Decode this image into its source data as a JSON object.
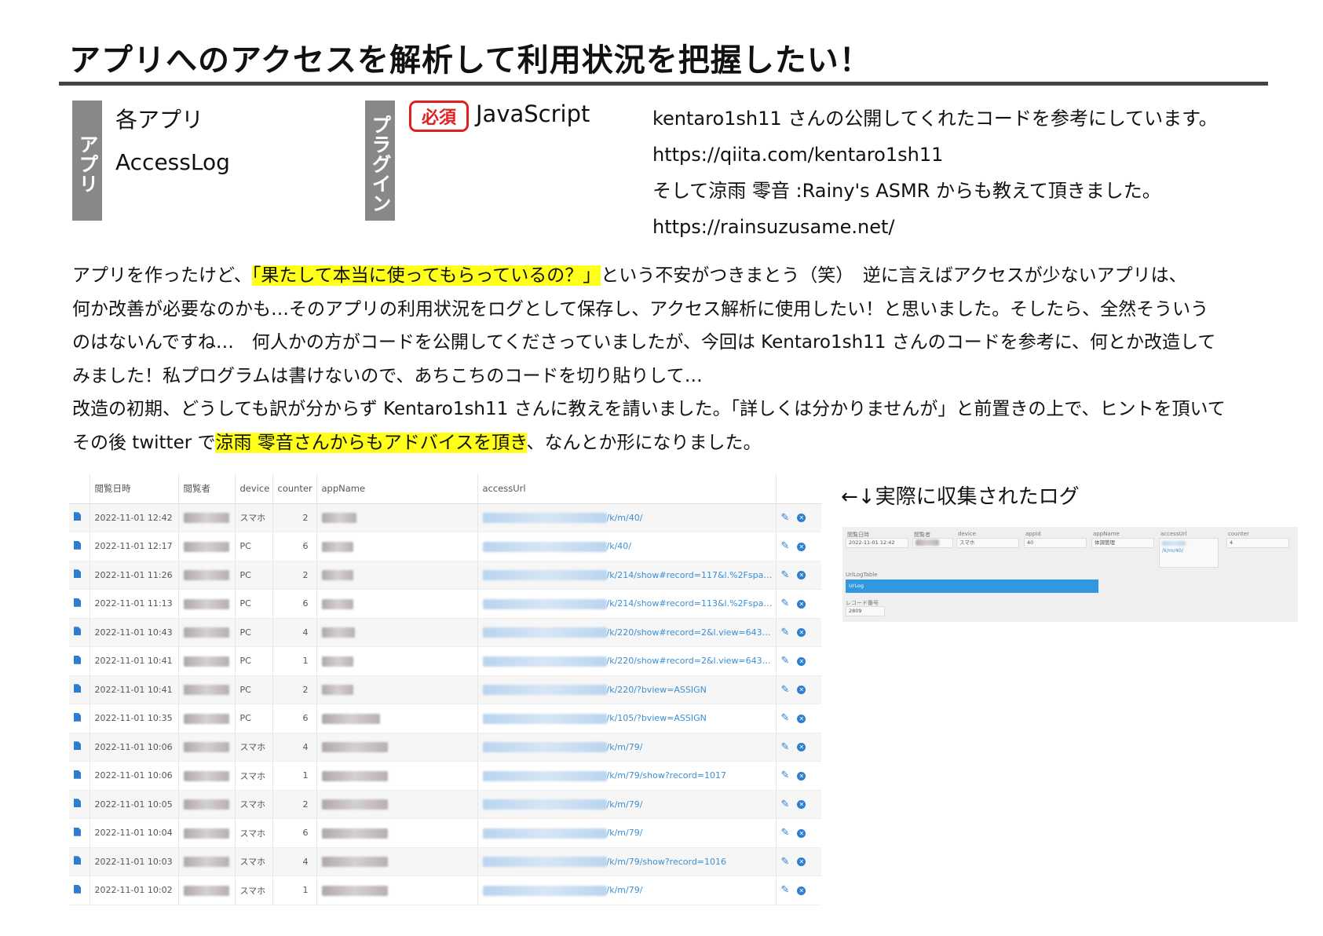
{
  "title": "アプリへのアクセスを解析して利用状況を把握したい！",
  "app_label": "アプリ",
  "app_names": [
    "各アプリ",
    "AccessLog"
  ],
  "plugin_label": "プラグイン",
  "required_badge": "必須",
  "required_value": "JavaScript",
  "credits": [
    "kentaro1sh11 さんの公開してくれたコードを参考にしています。",
    "https://qiita.com/kentaro1sh11",
    "そして涼雨 零音 :Rainy's ASMR からも教えて頂きました。",
    "https://rainsuzusame.net/"
  ],
  "body": {
    "l1_a": "アプリを作ったけど、",
    "l1_hl": "「果たして本当に使ってもらっているの？」",
    "l1_b": "という不安がつきまとう（笑）　逆に言えばアクセスが少ないアプリは、",
    "l2": "何か改善が必要なのかも…そのアプリの利用状況をログとして保存し、アクセス解析に使用したい！と思いました。そしたら、全然そういう",
    "l3": "のはないんですね…　何人かの方がコードを公開してくださっていましたが、今回は Kentaro1sh11 さんのコードを参考に、何とか改造して",
    "l4": "みました！私プログラムは書けないので、あちこちのコードを切り貼りして…",
    "l5": "改造の初期、どうしても訳が分からず Kentaro1sh11 さんに教えを請いました。「詳しくは分かりませんが」と前置きの上で、ヒントを頂いて",
    "l6_a": "その後 twitter で",
    "l6_hl": "涼雨 零音さんからもアドバイスを頂き",
    "l6_b": "、なんとか形になりました。"
  },
  "log_table": {
    "headers": [
      "閲覧日時",
      "閲覧者",
      "device",
      "counter",
      "appName",
      "accessUrl"
    ],
    "rows": [
      {
        "date": "2022-11-01 12:42",
        "device": "スマホ",
        "counter": "2",
        "url": "/k/m/40/"
      },
      {
        "date": "2022-11-01 12:17",
        "device": "PC",
        "counter": "6",
        "url": "/k/40/"
      },
      {
        "date": "2022-11-01 11:26",
        "device": "PC",
        "counter": "2",
        "url": "/k/214/show#record=117&l.%2Fspa…"
      },
      {
        "date": "2022-11-01 11:13",
        "device": "PC",
        "counter": "6",
        "url": "/k/214/show#record=113&l.%2Fspa…"
      },
      {
        "date": "2022-11-01 10:43",
        "device": "PC",
        "counter": "4",
        "url": "/k/220/show#record=2&l.view=643…"
      },
      {
        "date": "2022-11-01 10:41",
        "device": "PC",
        "counter": "1",
        "url": "/k/220/show#record=2&l.view=643…"
      },
      {
        "date": "2022-11-01 10:41",
        "device": "PC",
        "counter": "2",
        "url": "/k/220/?bview=ASSIGN"
      },
      {
        "date": "2022-11-01 10:35",
        "device": "PC",
        "counter": "6",
        "url": "/k/105/?bview=ASSIGN"
      },
      {
        "date": "2022-11-01 10:06",
        "device": "スマホ",
        "counter": "4",
        "url": "/k/m/79/"
      },
      {
        "date": "2022-11-01 10:06",
        "device": "スマホ",
        "counter": "1",
        "url": "/k/m/79/show?record=1017"
      },
      {
        "date": "2022-11-01 10:05",
        "device": "スマホ",
        "counter": "2",
        "url": "/k/m/79/"
      },
      {
        "date": "2022-11-01 10:04",
        "device": "スマホ",
        "counter": "6",
        "url": "/k/m/79/"
      },
      {
        "date": "2022-11-01 10:03",
        "device": "スマホ",
        "counter": "4",
        "url": "/k/m/79/show?record=1016"
      },
      {
        "date": "2022-11-01 10:02",
        "device": "スマホ",
        "counter": "1",
        "url": "/k/m/79/"
      }
    ]
  },
  "log_caption": "←↓実際に収集されたログ",
  "detail": {
    "labels": {
      "date": "閲覧日時",
      "user": "閲覧者",
      "device": "device",
      "appid": "appId",
      "appname": "appName",
      "url": "accessUrl",
      "counter": "counter",
      "table": "UrlLogTable",
      "record": "レコード番号"
    },
    "values": {
      "date": "2022-11-01 12:42",
      "device": "スマホ",
      "appid": "40",
      "appname": "体調管理",
      "url": "/k/m/40/",
      "counter": "4",
      "table": "UrLog",
      "record": "2809"
    }
  },
  "colors": {
    "highlight": "#ffff1a",
    "badge": "#e02020",
    "tab_bg": "#888888",
    "link_blue": "#3b8fd4"
  }
}
